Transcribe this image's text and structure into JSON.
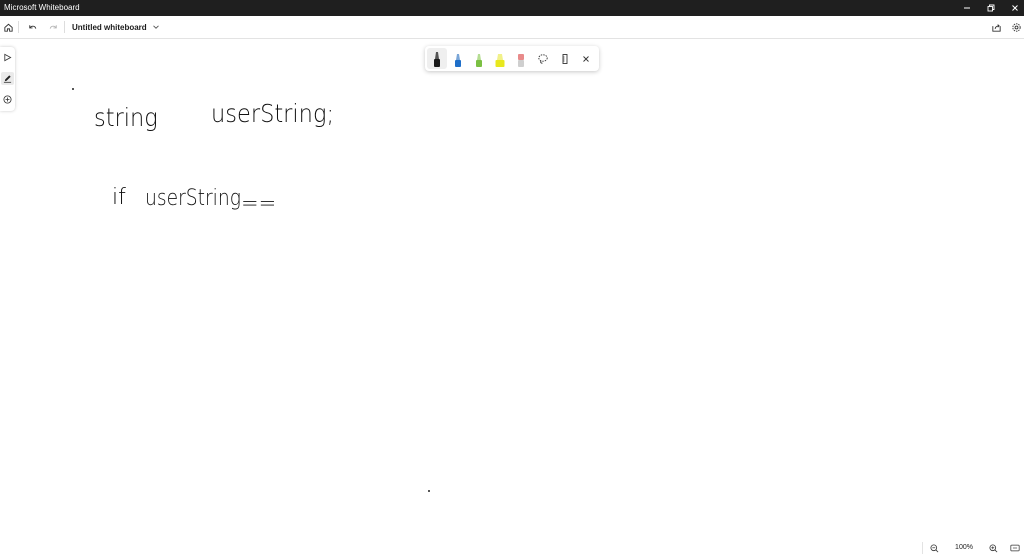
{
  "window": {
    "title": "Microsoft Whiteboard",
    "controls": {
      "minimize_icon": "minimize-icon",
      "restore_icon": "restore-icon",
      "close_icon": "close-icon"
    }
  },
  "toolbar": {
    "home_icon": "home-icon",
    "undo_icon": "undo-icon",
    "redo_icon": "redo-icon",
    "document_title": "Untitled whiteboard",
    "title_dropdown_icon": "chevron-down-icon",
    "share_icon": "share-icon",
    "settings_icon": "gear-icon"
  },
  "side_rail": {
    "items": [
      {
        "name": "select",
        "icon": "pointer-icon",
        "active": false
      },
      {
        "name": "inking",
        "icon": "pen-icon",
        "active": true
      },
      {
        "name": "create",
        "icon": "plus-circle-icon",
        "active": false
      }
    ]
  },
  "ink_tray": {
    "tools": [
      {
        "name": "pen-black",
        "icon": "pen-icon",
        "color": "#1a1a1a",
        "active": true
      },
      {
        "name": "pen-blue",
        "icon": "pen-icon",
        "color": "#1f6fc9",
        "active": false
      },
      {
        "name": "pen-green",
        "icon": "pen-icon",
        "color": "#7bc043",
        "active": false
      },
      {
        "name": "highlighter-yellow",
        "icon": "highlighter-icon",
        "color": "#e8e81e",
        "active": false
      },
      {
        "name": "eraser",
        "icon": "eraser-icon",
        "color": "#e88a8a",
        "active": false
      },
      {
        "name": "lasso",
        "icon": "lasso-icon",
        "active": false
      },
      {
        "name": "ruler",
        "icon": "ruler-icon",
        "active": false
      },
      {
        "name": "close",
        "icon": "close-icon",
        "active": false
      }
    ]
  },
  "canvas": {
    "ink_lines": [
      {
        "text": "string"
      },
      {
        "text": "userString;"
      },
      {
        "text": "if"
      },
      {
        "text": "userString"
      },
      {
        "text": "=="
      }
    ]
  },
  "statusbar": {
    "zoom_out_icon": "zoom-out-icon",
    "zoom_level": "100%",
    "zoom_in_icon": "zoom-in-icon",
    "fit_icon": "fit-to-screen-icon"
  }
}
